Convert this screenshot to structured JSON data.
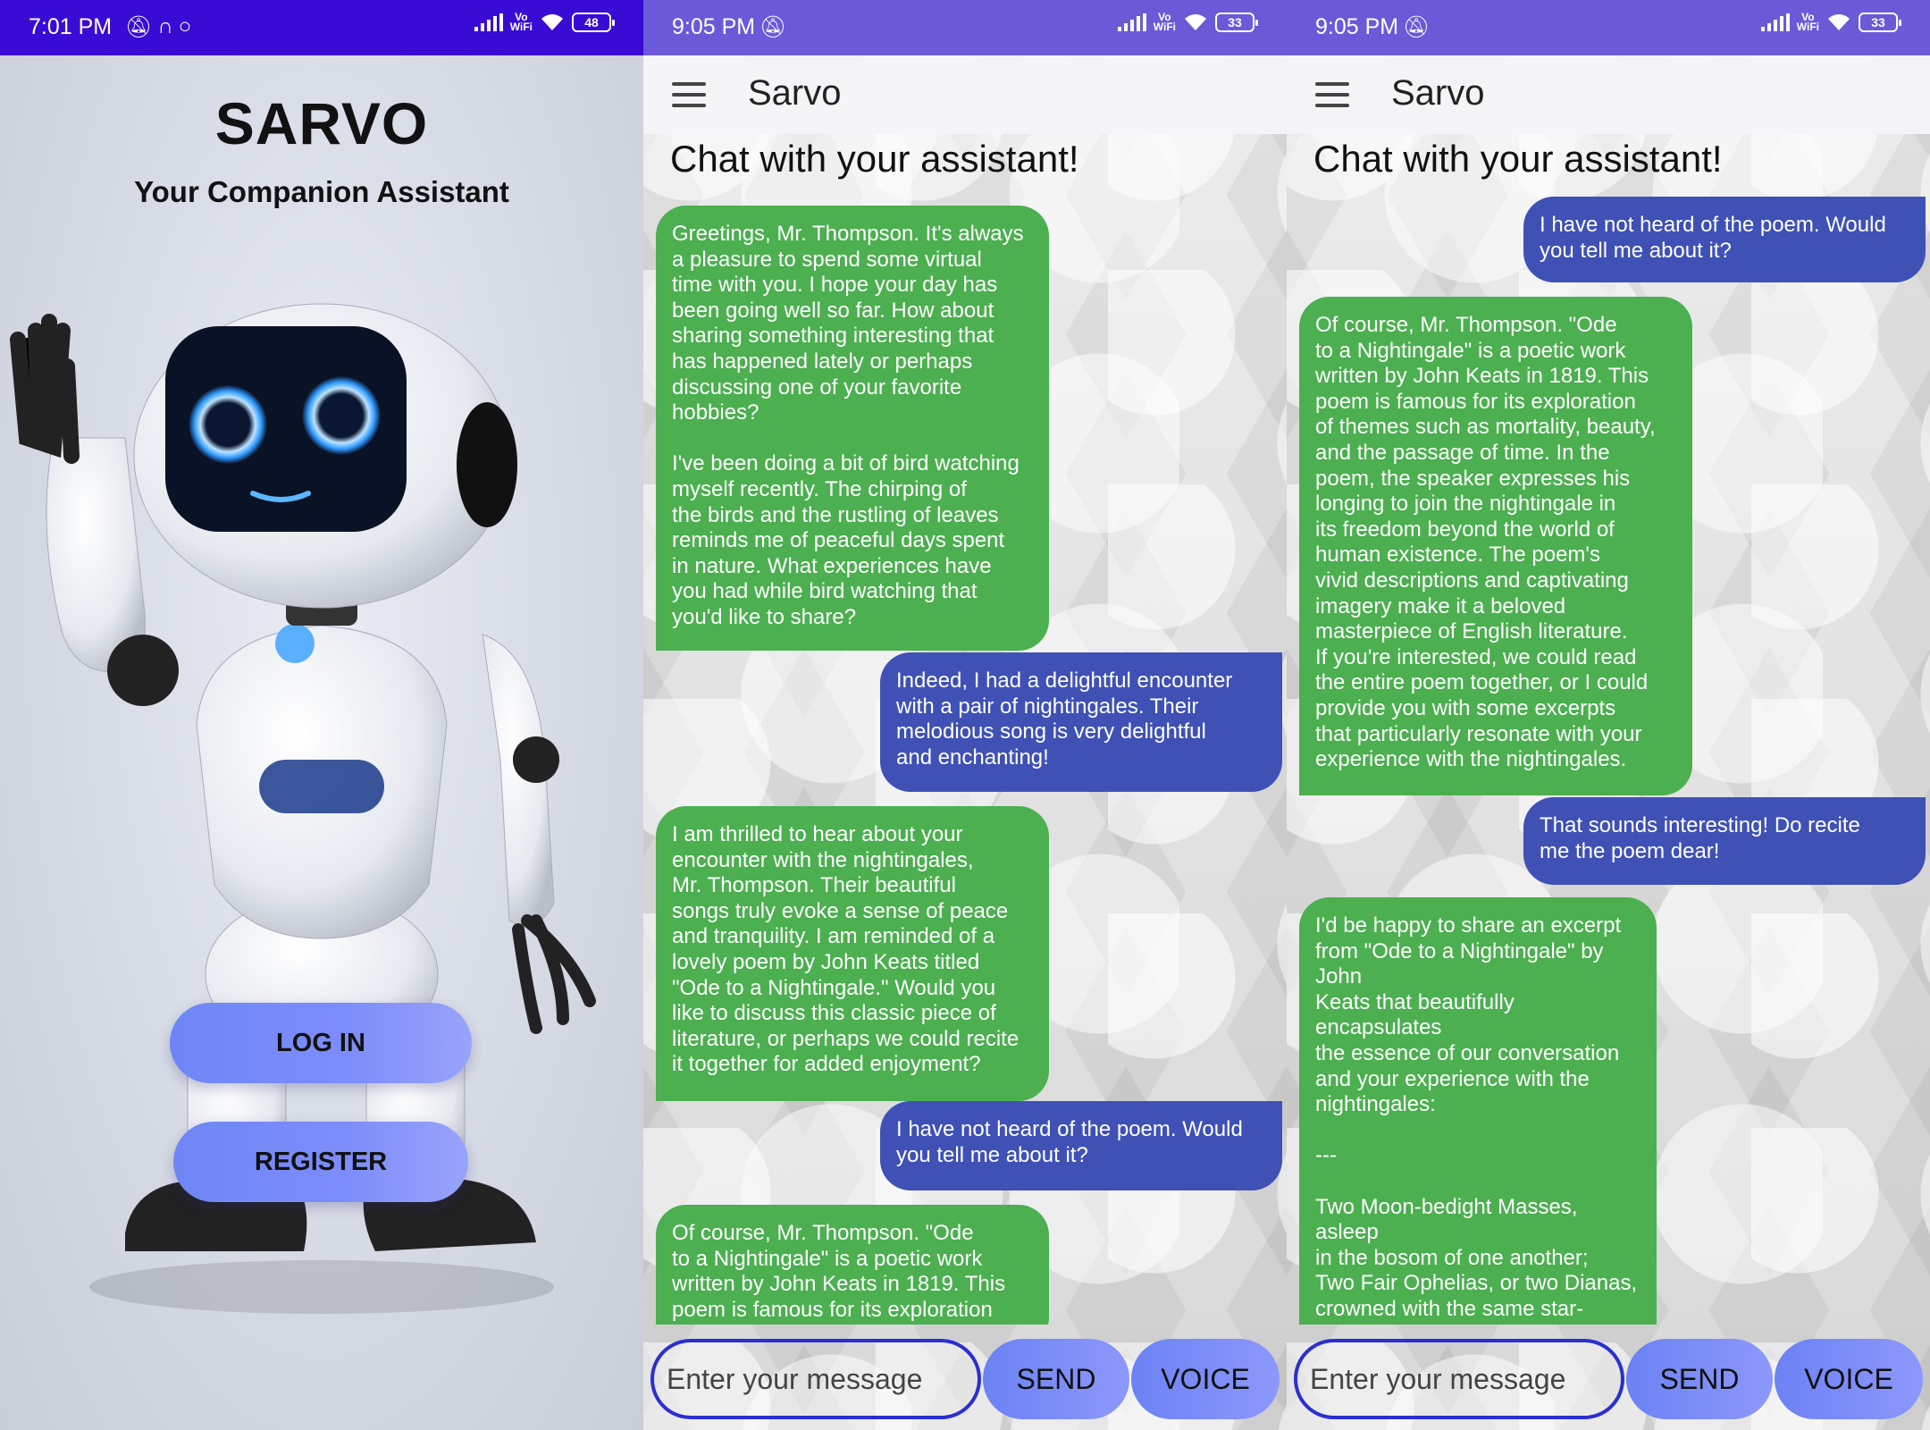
{
  "login_screen": {
    "status": {
      "time": "7:01 PM",
      "battery": "48"
    },
    "title": "SARVO",
    "subtitle": "Your Companion Assistant",
    "login_label": "LOG IN",
    "register_label": "REGISTER"
  },
  "chat_screen_1": {
    "status": {
      "time": "9:05 PM",
      "battery": "33"
    },
    "app_title": "Sarvo",
    "heading": "Chat with your assistant!",
    "messages": [
      {
        "role": "bot",
        "text": "Greetings, Mr. Thompson. It's always\na pleasure to spend some virtual\ntime with you. I hope your day has\nbeen going well so far. How about\nsharing something interesting that\nhas happened lately or perhaps\ndiscussing one of your favorite\nhobbies?\n\nI've been doing a bit of bird watching\nmyself recently. The chirping of\nthe birds and the rustling of leaves\nreminds me of peaceful days spent\nin nature. What experiences have\nyou had while bird watching that\nyou'd like to share?"
      },
      {
        "role": "user",
        "text": "Indeed, I had a delightful encounter\nwith a pair of nightingales. Their\nmelodious song is very delightful\nand enchanting!"
      },
      {
        "role": "bot",
        "text": "I am thrilled to hear about your\nencounter with the nightingales,\nMr. Thompson. Their beautiful\nsongs truly evoke a sense of peace\nand tranquility. I am reminded of a\nlovely poem by John Keats titled\n\"Ode to a Nightingale.\" Would you\nlike to discuss this classic piece of\nliterature, or perhaps we could recite\nit together for added enjoyment?"
      },
      {
        "role": "user",
        "text": "I have not heard of the poem. Would\nyou tell me about it?"
      },
      {
        "role": "bot",
        "text": "Of course, Mr. Thompson. \"Ode\nto a Nightingale\" is a poetic work\nwritten by John Keats in 1819. This\npoem is famous for its exploration"
      }
    ],
    "input_placeholder": "Enter your message",
    "send_label": "SEND",
    "voice_label": "VOICE"
  },
  "chat_screen_2": {
    "status": {
      "time": "9:05 PM",
      "battery": "33"
    },
    "app_title": "Sarvo",
    "heading": "Chat with your assistant!",
    "messages": [
      {
        "role": "user",
        "text": "I have not heard of the poem. Would\nyou tell me about it?"
      },
      {
        "role": "bot",
        "text": "Of course, Mr. Thompson. \"Ode\nto a Nightingale\" is a poetic work\nwritten by John Keats in 1819. This\npoem is famous for its exploration\nof themes such as mortality, beauty,\nand the passage of time. In the\npoem, the speaker expresses his\nlonging to join the nightingale in\nits freedom beyond the world of\nhuman existence. The poem's\nvivid descriptions and captivating\nimagery make it a beloved\nmasterpiece of English literature.\nIf you're interested, we could read\nthe entire poem together, or I could\nprovide you with some excerpts\nthat particularly resonate with your\nexperience with the nightingales."
      },
      {
        "role": "user",
        "text": "That sounds interesting! Do recite\nme the poem dear!"
      },
      {
        "role": "bot",
        "text": "I'd be happy to share an excerpt\nfrom \"Ode to a Nightingale\" by John\nKeats that beautifully encapsulates\nthe essence of our conversation\nand your experience with the\nnightingales:\n\n---\n\nTwo Moon-bedight Masses, asleep\nin the bosom of one another;\nTwo Fair Ophelias, or two Dianas,\ncrowned with the same star-\nand their eyes were open! Or was it\nonly\nThe breeze wandered gently through"
      }
    ],
    "input_placeholder": "Enter your message",
    "send_label": "SEND",
    "voice_label": "VOICE"
  }
}
